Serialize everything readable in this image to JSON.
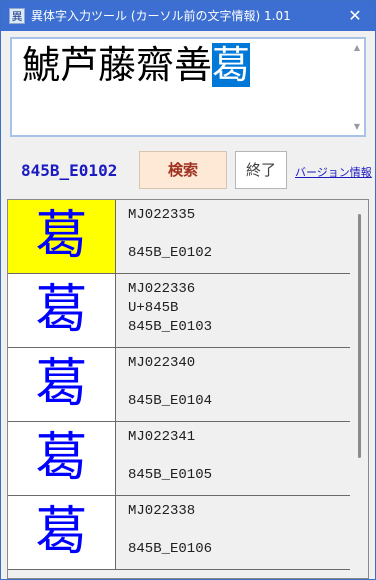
{
  "window": {
    "icon": "異",
    "title": "異体字入力ツール (カーソル前の文字情報) 1.01",
    "close_icon": "✕"
  },
  "input": {
    "text_before": "鯱芦藤齋善",
    "selected_char": "葛",
    "scroll_up_icon": "▲",
    "scroll_down_icon": "▼"
  },
  "toolbar": {
    "code": "845B_E0102",
    "search_label": "検索",
    "end_label": "終了",
    "version_label": "バージョン情報"
  },
  "variants": [
    {
      "glyph": "葛",
      "selected": true,
      "lines": [
        "MJ022335",
        "",
        "845B_E0102"
      ]
    },
    {
      "glyph": "葛",
      "selected": false,
      "lines": [
        "MJ022336",
        "U+845B",
        "845B_E0103"
      ]
    },
    {
      "glyph": "葛",
      "selected": false,
      "lines": [
        "MJ022340",
        "",
        "845B_E0104"
      ]
    },
    {
      "glyph": "葛",
      "selected": false,
      "lines": [
        "MJ022341",
        "",
        "845B_E0105"
      ]
    },
    {
      "glyph": "葛",
      "selected": false,
      "lines": [
        "MJ022338",
        "",
        "845B_E0106"
      ]
    }
  ],
  "colors": {
    "titlebar": "#3c6fd1",
    "selected_cell": "#ffff00",
    "glyph": "#0000ff",
    "code_text": "#1a1ac0",
    "search_button": "#fde9d5"
  }
}
